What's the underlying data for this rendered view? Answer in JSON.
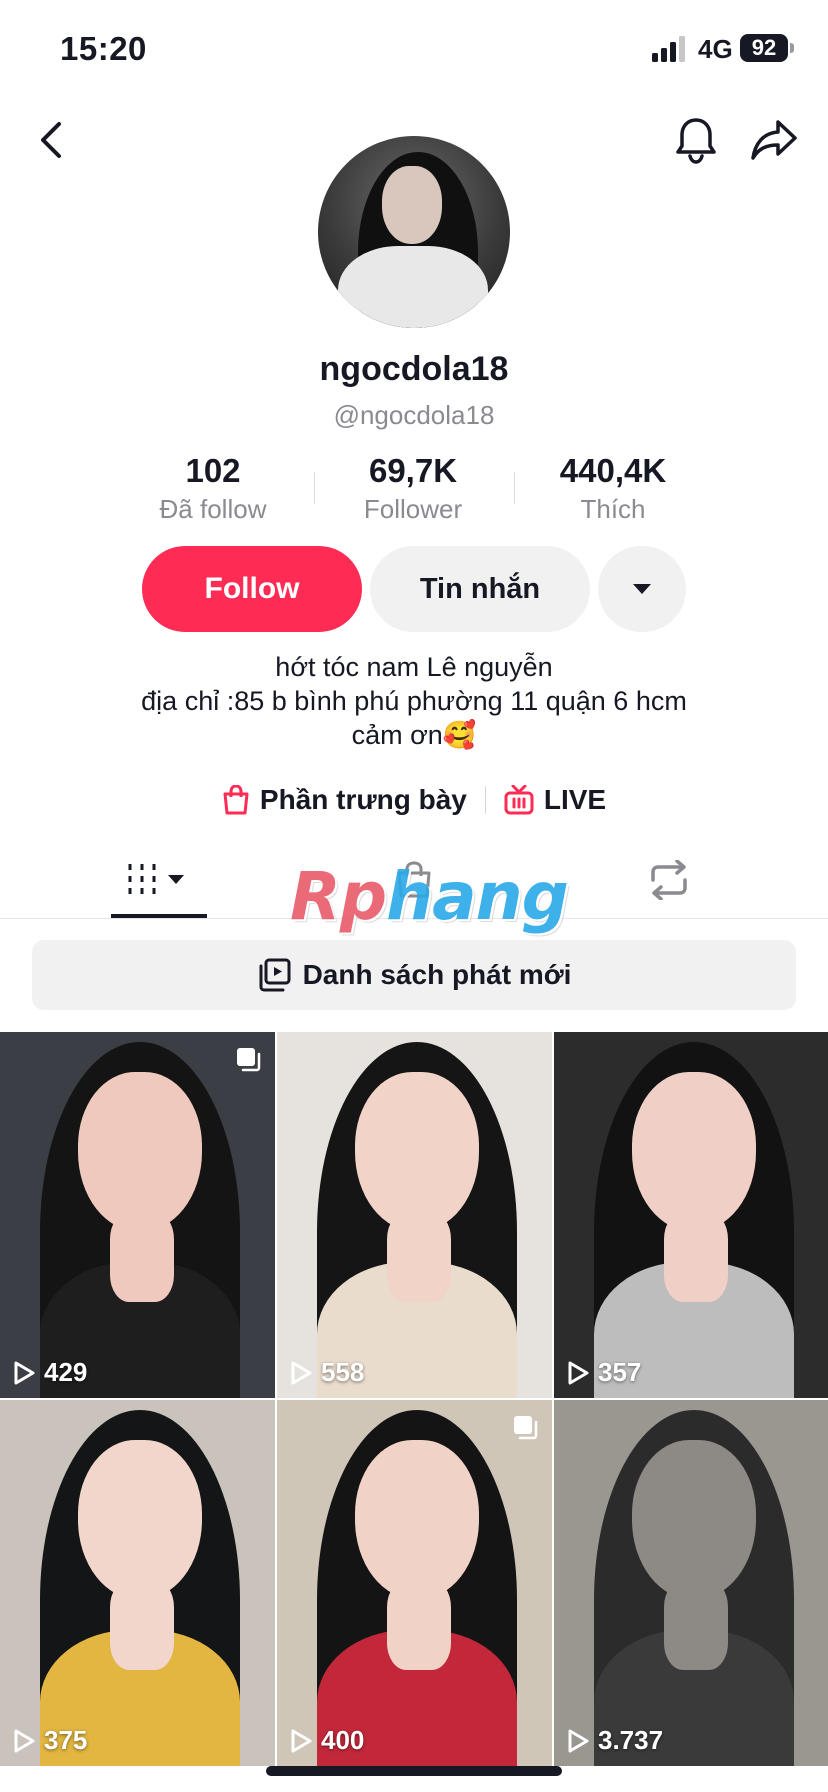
{
  "status_bar": {
    "time": "15:20",
    "network": "4G",
    "battery": "92"
  },
  "profile": {
    "display_name": "ngocdola18",
    "handle": "@ngocdola18",
    "stats": [
      {
        "value": "102",
        "label": "Đã follow"
      },
      {
        "value": "69,7K",
        "label": "Follower"
      },
      {
        "value": "440,4K",
        "label": "Thích"
      }
    ],
    "follow_label": "Follow",
    "message_label": "Tin nhắn",
    "bio_lines": [
      "hớt tóc nam Lê nguyễn",
      "địa chỉ :85 b bình phú phường 11 quận 6 hcm",
      "cảm ơn🥰"
    ],
    "showcase_label": "Phần trưng bày",
    "live_label": "LIVE"
  },
  "watermark": {
    "part1": "Rp",
    "part2": "hang"
  },
  "playlist_label": "Danh sách phát mới",
  "videos": [
    {
      "views": "429",
      "multi": true,
      "bg": "#3b3f45",
      "skin": "#efc9bd",
      "hair": "#141414",
      "top": "#1e1e1e"
    },
    {
      "views": "558",
      "multi": false,
      "bg": "#e6e3de",
      "skin": "#f1d3c8",
      "hair": "#151515",
      "top": "#e9dccd"
    },
    {
      "views": "357",
      "multi": false,
      "bg": "#2c2c2c",
      "skin": "#f0d0c6",
      "hair": "#121212",
      "top": "#bdbdbd"
    },
    {
      "views": "375",
      "multi": false,
      "bg": "#c9c3bc",
      "skin": "#f2d6cc",
      "hair": "#131516",
      "top": "#e2b640"
    },
    {
      "views": "400",
      "multi": true,
      "bg": "#cfc6b8",
      "skin": "#f1d2c7",
      "hair": "#141414",
      "top": "#c2283a"
    },
    {
      "views": "3.737",
      "multi": false,
      "bg": "#9a9690",
      "skin": "#8d8a86",
      "hair": "#2b2b2b",
      "top": "#3a3a3a"
    }
  ]
}
